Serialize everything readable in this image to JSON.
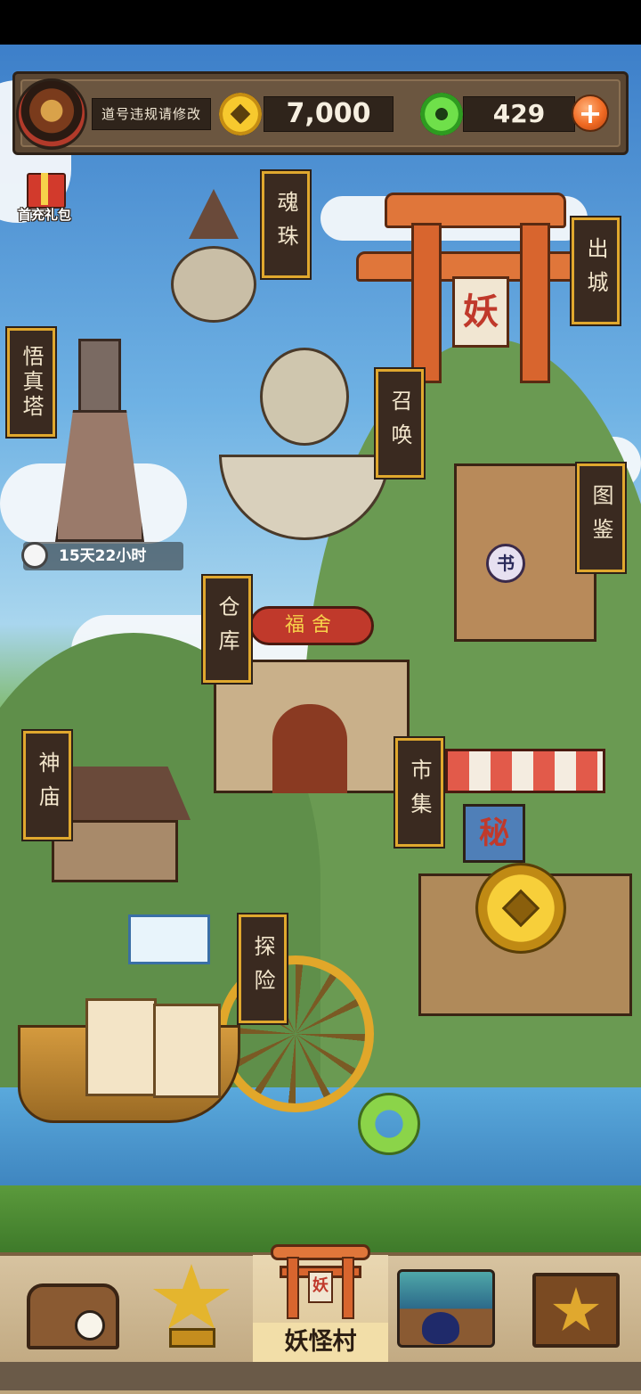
{
  "player": {
    "name_notice": "道号违规请修改"
  },
  "currency": {
    "gold": "7,000",
    "jade": "429",
    "add_symbol": "+"
  },
  "gift": {
    "label": "首充礼包"
  },
  "buildings": {
    "soul_orb": "魂珠",
    "exit_city": "出城",
    "wukong_tower": "悟真塔",
    "summon": "召唤",
    "codex": "图鉴",
    "warehouse": "仓库",
    "temple": "神庙",
    "market": "市集",
    "explore": "探险"
  },
  "signs": {
    "yao": "妖",
    "book": "书",
    "fu_she": "福舍",
    "mi": "秘"
  },
  "event_timer": "15天22小时",
  "bottom_nav": {
    "active_label": "妖怪村"
  },
  "colors": {
    "label_bg": "#3a2a20",
    "label_border": "#e0a82e",
    "accent_orange": "#f06a23"
  }
}
